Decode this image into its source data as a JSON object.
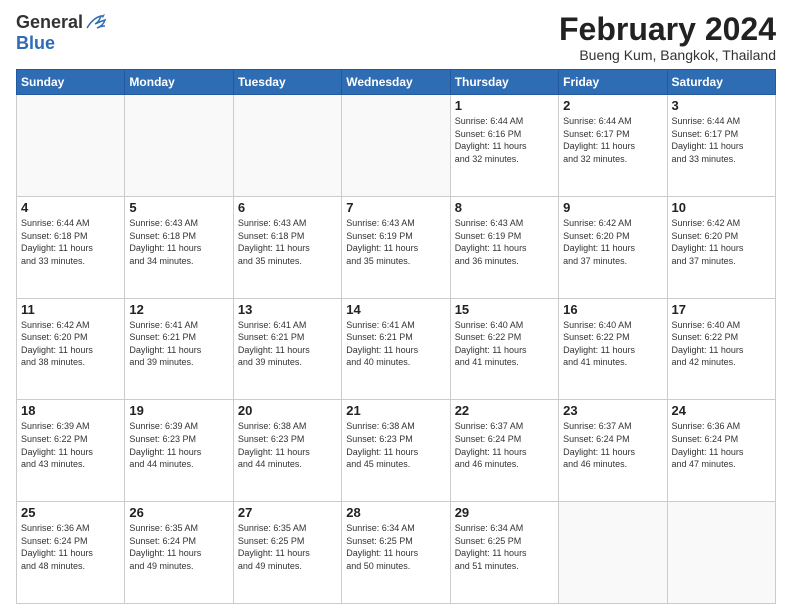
{
  "header": {
    "logo_general": "General",
    "logo_blue": "Blue",
    "month_title": "February 2024",
    "location": "Bueng Kum, Bangkok, Thailand"
  },
  "weekdays": [
    "Sunday",
    "Monday",
    "Tuesday",
    "Wednesday",
    "Thursday",
    "Friday",
    "Saturday"
  ],
  "weeks": [
    [
      {
        "day": "",
        "info": ""
      },
      {
        "day": "",
        "info": ""
      },
      {
        "day": "",
        "info": ""
      },
      {
        "day": "",
        "info": ""
      },
      {
        "day": "1",
        "info": "Sunrise: 6:44 AM\nSunset: 6:16 PM\nDaylight: 11 hours\nand 32 minutes."
      },
      {
        "day": "2",
        "info": "Sunrise: 6:44 AM\nSunset: 6:17 PM\nDaylight: 11 hours\nand 32 minutes."
      },
      {
        "day": "3",
        "info": "Sunrise: 6:44 AM\nSunset: 6:17 PM\nDaylight: 11 hours\nand 33 minutes."
      }
    ],
    [
      {
        "day": "4",
        "info": "Sunrise: 6:44 AM\nSunset: 6:18 PM\nDaylight: 11 hours\nand 33 minutes."
      },
      {
        "day": "5",
        "info": "Sunrise: 6:43 AM\nSunset: 6:18 PM\nDaylight: 11 hours\nand 34 minutes."
      },
      {
        "day": "6",
        "info": "Sunrise: 6:43 AM\nSunset: 6:18 PM\nDaylight: 11 hours\nand 35 minutes."
      },
      {
        "day": "7",
        "info": "Sunrise: 6:43 AM\nSunset: 6:19 PM\nDaylight: 11 hours\nand 35 minutes."
      },
      {
        "day": "8",
        "info": "Sunrise: 6:43 AM\nSunset: 6:19 PM\nDaylight: 11 hours\nand 36 minutes."
      },
      {
        "day": "9",
        "info": "Sunrise: 6:42 AM\nSunset: 6:20 PM\nDaylight: 11 hours\nand 37 minutes."
      },
      {
        "day": "10",
        "info": "Sunrise: 6:42 AM\nSunset: 6:20 PM\nDaylight: 11 hours\nand 37 minutes."
      }
    ],
    [
      {
        "day": "11",
        "info": "Sunrise: 6:42 AM\nSunset: 6:20 PM\nDaylight: 11 hours\nand 38 minutes."
      },
      {
        "day": "12",
        "info": "Sunrise: 6:41 AM\nSunset: 6:21 PM\nDaylight: 11 hours\nand 39 minutes."
      },
      {
        "day": "13",
        "info": "Sunrise: 6:41 AM\nSunset: 6:21 PM\nDaylight: 11 hours\nand 39 minutes."
      },
      {
        "day": "14",
        "info": "Sunrise: 6:41 AM\nSunset: 6:21 PM\nDaylight: 11 hours\nand 40 minutes."
      },
      {
        "day": "15",
        "info": "Sunrise: 6:40 AM\nSunset: 6:22 PM\nDaylight: 11 hours\nand 41 minutes."
      },
      {
        "day": "16",
        "info": "Sunrise: 6:40 AM\nSunset: 6:22 PM\nDaylight: 11 hours\nand 41 minutes."
      },
      {
        "day": "17",
        "info": "Sunrise: 6:40 AM\nSunset: 6:22 PM\nDaylight: 11 hours\nand 42 minutes."
      }
    ],
    [
      {
        "day": "18",
        "info": "Sunrise: 6:39 AM\nSunset: 6:22 PM\nDaylight: 11 hours\nand 43 minutes."
      },
      {
        "day": "19",
        "info": "Sunrise: 6:39 AM\nSunset: 6:23 PM\nDaylight: 11 hours\nand 44 minutes."
      },
      {
        "day": "20",
        "info": "Sunrise: 6:38 AM\nSunset: 6:23 PM\nDaylight: 11 hours\nand 44 minutes."
      },
      {
        "day": "21",
        "info": "Sunrise: 6:38 AM\nSunset: 6:23 PM\nDaylight: 11 hours\nand 45 minutes."
      },
      {
        "day": "22",
        "info": "Sunrise: 6:37 AM\nSunset: 6:24 PM\nDaylight: 11 hours\nand 46 minutes."
      },
      {
        "day": "23",
        "info": "Sunrise: 6:37 AM\nSunset: 6:24 PM\nDaylight: 11 hours\nand 46 minutes."
      },
      {
        "day": "24",
        "info": "Sunrise: 6:36 AM\nSunset: 6:24 PM\nDaylight: 11 hours\nand 47 minutes."
      }
    ],
    [
      {
        "day": "25",
        "info": "Sunrise: 6:36 AM\nSunset: 6:24 PM\nDaylight: 11 hours\nand 48 minutes."
      },
      {
        "day": "26",
        "info": "Sunrise: 6:35 AM\nSunset: 6:24 PM\nDaylight: 11 hours\nand 49 minutes."
      },
      {
        "day": "27",
        "info": "Sunrise: 6:35 AM\nSunset: 6:25 PM\nDaylight: 11 hours\nand 49 minutes."
      },
      {
        "day": "28",
        "info": "Sunrise: 6:34 AM\nSunset: 6:25 PM\nDaylight: 11 hours\nand 50 minutes."
      },
      {
        "day": "29",
        "info": "Sunrise: 6:34 AM\nSunset: 6:25 PM\nDaylight: 11 hours\nand 51 minutes."
      },
      {
        "day": "",
        "info": ""
      },
      {
        "day": "",
        "info": ""
      }
    ]
  ]
}
